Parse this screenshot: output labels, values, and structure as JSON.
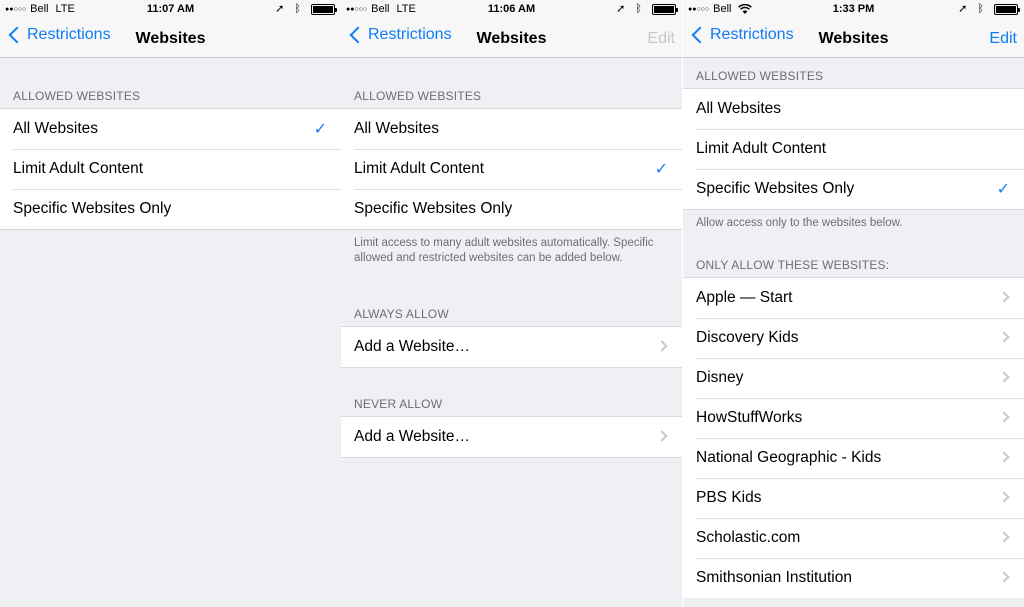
{
  "panels": [
    {
      "status": {
        "carrier": "Bell",
        "network": "LTE",
        "time": "11:07 AM"
      },
      "nav": {
        "back": "Restrictions",
        "title": "Websites",
        "edit": ""
      },
      "allowed_header": "ALLOWED WEBSITES",
      "options": [
        "All Websites",
        "Limit Adult Content",
        "Specific Websites Only"
      ],
      "selected": 0
    },
    {
      "status": {
        "carrier": "Bell",
        "network": "LTE",
        "time": "11:06 AM"
      },
      "nav": {
        "back": "Restrictions",
        "title": "Websites",
        "edit": "Edit"
      },
      "allowed_header": "ALLOWED WEBSITES",
      "options": [
        "All Websites",
        "Limit Adult Content",
        "Specific Websites Only"
      ],
      "selected": 1,
      "footer": "Limit access to many adult websites automatically. Specific allowed and restricted websites can be added below.",
      "always_header": "ALWAYS ALLOW",
      "always_add": "Add a Website…",
      "never_header": "NEVER ALLOW",
      "never_add": "Add a Website…"
    },
    {
      "status": {
        "carrier": "Bell",
        "network": "",
        "time": "1:33 PM"
      },
      "nav": {
        "back": "Restrictions",
        "title": "Websites",
        "edit": "Edit"
      },
      "allowed_header": "ALLOWED WEBSITES",
      "options": [
        "All Websites",
        "Limit Adult Content",
        "Specific Websites Only"
      ],
      "selected": 2,
      "footer": "Allow access only to the websites below.",
      "only_header": "ONLY ALLOW THESE WEBSITES:",
      "sites": [
        "Apple — Start",
        "Discovery Kids",
        "Disney",
        "HowStuffWorks",
        "National Geographic - Kids",
        "PBS Kids",
        "Scholastic.com",
        "Smithsonian Institution"
      ]
    }
  ],
  "icons": {
    "check": "checkmark-icon",
    "disclosure": "chevron-right-icon",
    "back": "chevron-left-icon",
    "location": "location-arrow-icon",
    "bluetooth": "bluetooth-icon",
    "wifi": "wifi-icon"
  },
  "colors": {
    "accent": "#117cf5",
    "background": "#efeff4",
    "secondary_text": "#6d6d72",
    "disabled": "#c7c7cc"
  }
}
